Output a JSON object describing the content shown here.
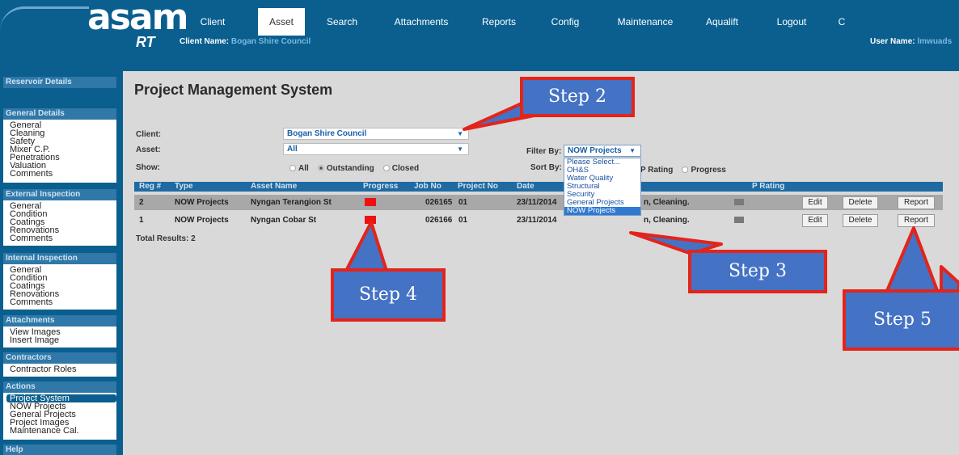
{
  "header": {
    "logo_text": "asam",
    "logo_sub": "RT",
    "client_label": "Client Name:",
    "client_value": "Bogan Shire Council",
    "user_label": "User Name:",
    "user_value": "lmwuads",
    "nav": [
      "Client",
      "Asset",
      "Search",
      "Attachments",
      "Reports",
      "Config",
      "Maintenance",
      "Aqualift",
      "Logout",
      "C"
    ],
    "active_nav": "Asset"
  },
  "sidebar": {
    "reservoir": "Reservoir Details",
    "general_head": "General Details",
    "general_items": [
      "General",
      "Cleaning",
      "Safety",
      "Mixer C.P.",
      "Penetrations",
      "Valuation",
      "Comments"
    ],
    "external_head": "External Inspection",
    "external_items": [
      "General",
      "Condition",
      "Coatings",
      "Renovations",
      "Comments"
    ],
    "internal_head": "Internal Inspection",
    "internal_items": [
      "General",
      "Condition",
      "Coatings",
      "Renovations",
      "Comments"
    ],
    "attachments_head": "Attachments",
    "attachments_items": [
      "View Images",
      "Insert Image"
    ],
    "contractors_head": "Contractors",
    "contractors_items": [
      "Contractor Roles"
    ],
    "actions_head": "Actions",
    "actions_items": [
      "Project System",
      "NOW Projects",
      "General Projects",
      "Project Images",
      "Maintenance Cal."
    ],
    "help_head": "Help"
  },
  "main": {
    "title": "Project Management System",
    "client_label": "Client:",
    "client_value": "Bogan Shire Council",
    "asset_label": "Asset:",
    "asset_value": "All",
    "show_label": "Show:",
    "show_options": [
      "All",
      "Outstanding",
      "Closed"
    ],
    "show_selected": "Outstanding",
    "filter_label": "Filter By:",
    "filter_value": "NOW Projects",
    "filter_options": [
      "Please Select...",
      "OH&S",
      "Water Quality",
      "Structural",
      "Security",
      "General Projects",
      "NOW Projects"
    ],
    "sort_label": "Sort By:",
    "sort_options": [
      "P Rating",
      "Progress"
    ],
    "columns": [
      "Reg #",
      "Type",
      "Asset Name",
      "Progress",
      "Job No",
      "Project No",
      "Date",
      "P Rating"
    ],
    "rows": [
      {
        "reg": "2",
        "type": "NOW Projects",
        "asset": "Nyngan Terangion St",
        "job": "026165",
        "project": "01",
        "date": "23/11/2014",
        "desc": "n, Cleaning.",
        "progress_color": "#ee1111",
        "rating_color": "#7a7a7a"
      },
      {
        "reg": "1",
        "type": "NOW Projects",
        "asset": "Nyngan Cobar St",
        "job": "026166",
        "project": "01",
        "date": "23/11/2014",
        "desc": "n, Cleaning.",
        "progress_color": "#ee1111",
        "rating_color": "#7a7a7a"
      }
    ],
    "btn_edit": "Edit",
    "btn_delete": "Delete",
    "btn_report": "Report",
    "total": "Total Results: 2"
  },
  "callouts": {
    "step2": "Step 2",
    "step3": "Step 3",
    "step4": "Step 4",
    "step5": "Step 5"
  },
  "colors": {
    "header_bg": "#0a5f8f",
    "callout_fill": "#4472c4",
    "callout_border": "#e3241b",
    "progress": "#ee1111"
  }
}
